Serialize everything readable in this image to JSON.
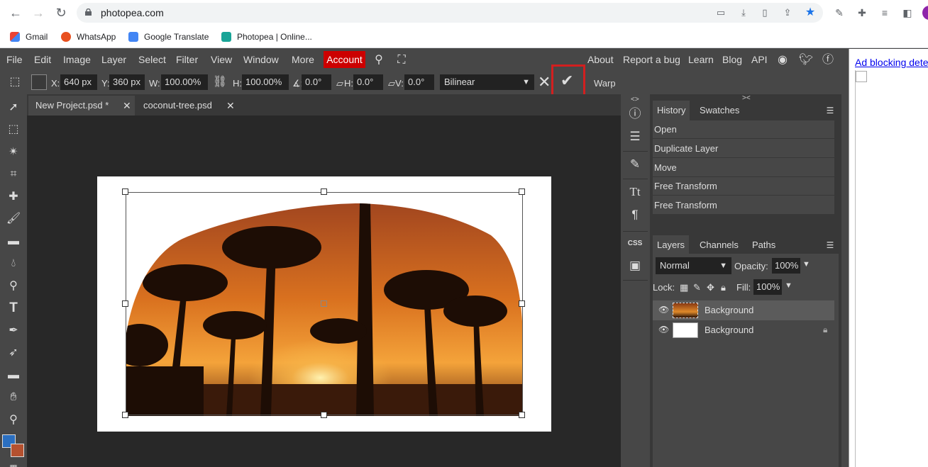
{
  "browser": {
    "url": "photopea.com",
    "bookmarks": [
      "Gmail",
      "WhatsApp",
      "Google Translate",
      "Photopea | Online..."
    ]
  },
  "menubar": {
    "items": [
      "File",
      "Edit",
      "Image",
      "Layer",
      "Select",
      "Filter",
      "View",
      "Window",
      "More"
    ],
    "account": "Account",
    "right_items": [
      "About",
      "Report a bug",
      "Learn",
      "Blog",
      "API"
    ]
  },
  "options": {
    "x_label": "X:",
    "x_value": "640 px",
    "y_label": "Y:",
    "y_value": "360 px",
    "w_label": "W:",
    "w_value": "100.00%",
    "h_label": "H:",
    "h_value": "100.00%",
    "angle_label": "∡:",
    "angle_value": "0.0°",
    "hskew_label": "H:",
    "hskew_value": "0.0°",
    "vskew_label": "V:",
    "vskew_value": "0.0°",
    "interpolation": "Bilinear",
    "warp": "Warp"
  },
  "tabs": [
    {
      "label": "New Project.psd *"
    },
    {
      "label": "coconut-tree.psd"
    }
  ],
  "history": {
    "tabs": [
      "History",
      "Swatches"
    ],
    "items": [
      "Open",
      "Duplicate Layer",
      "Move",
      "Free Transform",
      "Free Transform"
    ]
  },
  "layers": {
    "tabs": [
      "Layers",
      "Channels",
      "Paths"
    ],
    "blend_mode": "Normal",
    "opacity_label": "Opacity:",
    "opacity": "100%",
    "lock_label": "Lock:",
    "fill_label": "Fill:",
    "fill": "100%",
    "rows": [
      {
        "name": "Background"
      },
      {
        "name": "Background"
      }
    ]
  },
  "ad": {
    "text": "Ad blocking detec"
  },
  "colors": {
    "accent_red": "#cc0000",
    "highlight_box": "#d21f1f",
    "foreground": "#2b6fc0",
    "background": "#b5512f"
  }
}
